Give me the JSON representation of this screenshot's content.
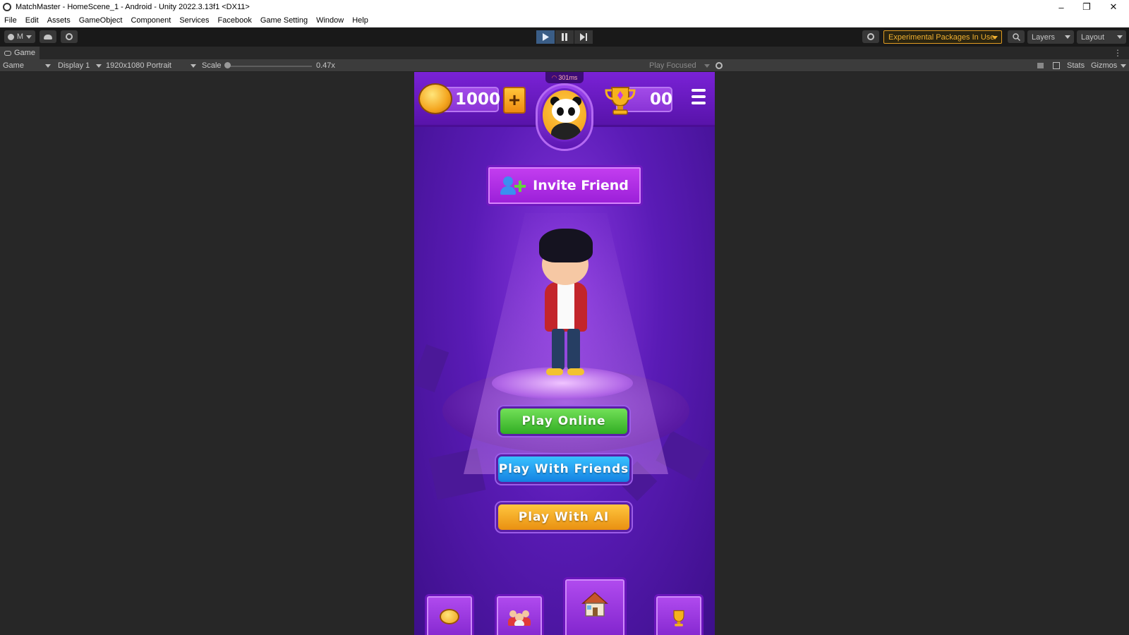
{
  "window": {
    "title": "MatchMaster - HomeScene_1 - Android - Unity 2022.3.13f1 <DX11>",
    "minimize": "–",
    "restore": "❐",
    "close": "✕"
  },
  "menu": [
    "File",
    "Edit",
    "Assets",
    "GameObject",
    "Component",
    "Services",
    "Facebook",
    "Game Setting",
    "Window",
    "Help"
  ],
  "toolbar": {
    "account_label": "M",
    "experimental_label": "Experimental Packages In Use",
    "layers_label": "Layers",
    "layout_label": "Layout"
  },
  "game_tab": {
    "tab_label": "Game",
    "view_select": "Game",
    "display_select": "Display 1",
    "resolution_select": "1920x1080 Portrait",
    "scale_label": "Scale",
    "scale_value": "0.47x",
    "play_focused": "Play Focused",
    "stats_label": "Stats",
    "gizmos_label": "Gizmos"
  },
  "game": {
    "latency": "301ms",
    "coins": "1000",
    "plus": "+",
    "trophies": "00",
    "invite_label": "Invite Friend",
    "play_online": "Play Online",
    "play_with_friends": "Play With Friends",
    "play_with_ai": "Play With AI",
    "nav": [
      "coins-icon",
      "friends-icon",
      "home-icon",
      "trophy-icon"
    ]
  },
  "colors": {
    "editor_bg": "#282828",
    "game_purple": "#5a1bb6",
    "online_green": "#32ad24",
    "friends_blue": "#1582e2",
    "ai_orange": "#e99011",
    "experimental_accent": "#f0b030"
  }
}
